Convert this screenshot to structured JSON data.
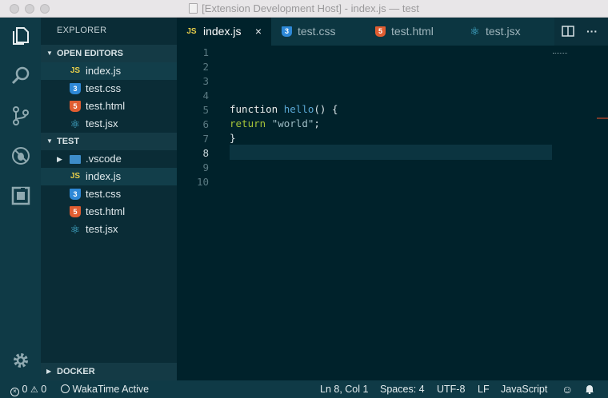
{
  "window": {
    "title": "[Extension Development Host] - index.js — test"
  },
  "activity_bar": {
    "icons": [
      "files-icon",
      "search-icon",
      "source-control-icon",
      "debug-icon",
      "extensions-icon",
      "settings-gear-icon"
    ]
  },
  "sidebar": {
    "title": "EXPLORER",
    "open_editors": {
      "label": "OPEN EDITORS",
      "items": [
        {
          "name": "index.js",
          "type": "js",
          "active": true
        },
        {
          "name": "test.css",
          "type": "css"
        },
        {
          "name": "test.html",
          "type": "html"
        },
        {
          "name": "test.jsx",
          "type": "jsx"
        }
      ]
    },
    "folder": {
      "label": "TEST",
      "items": [
        {
          "name": ".vscode",
          "type": "folder"
        },
        {
          "name": "index.js",
          "type": "js",
          "active": true
        },
        {
          "name": "test.css",
          "type": "css"
        },
        {
          "name": "test.html",
          "type": "html"
        },
        {
          "name": "test.jsx",
          "type": "jsx"
        }
      ]
    },
    "docker": {
      "label": "DOCKER"
    }
  },
  "tabs": [
    {
      "label": "index.js",
      "type": "js",
      "active": true,
      "close": "×"
    },
    {
      "label": "test.css",
      "type": "css"
    },
    {
      "label": "test.html",
      "type": "html"
    },
    {
      "label": "test.jsx",
      "type": "jsx"
    }
  ],
  "tab_actions": {
    "split": "split-editor-icon",
    "more": "···"
  },
  "editor": {
    "line_numbers": [
      "1",
      "2",
      "3",
      "4",
      "5",
      "6",
      "7",
      "8",
      "9",
      "10"
    ],
    "current_line": "8",
    "code": {
      "line5_kw": "function",
      "line5_fn": "hello",
      "line5_rest": "() {",
      "line6_kw": "return",
      "line6_str": "\"world\"",
      "line6_end": ";",
      "line7": "}"
    }
  },
  "status": {
    "errors": "0",
    "warnings": "0",
    "wakatime": "WakaTime Active",
    "position": "Ln 8, Col 1",
    "spaces": "Spaces: 4",
    "encoding": "UTF-8",
    "eol": "LF",
    "language": "JavaScript"
  },
  "colors": {
    "editor_bg": "#00222b",
    "sidebar_bg": "#0a2c36",
    "activity_bg": "#0f3a46",
    "keyword_return": "#a3c239",
    "function_name": "#5aa9d6"
  }
}
